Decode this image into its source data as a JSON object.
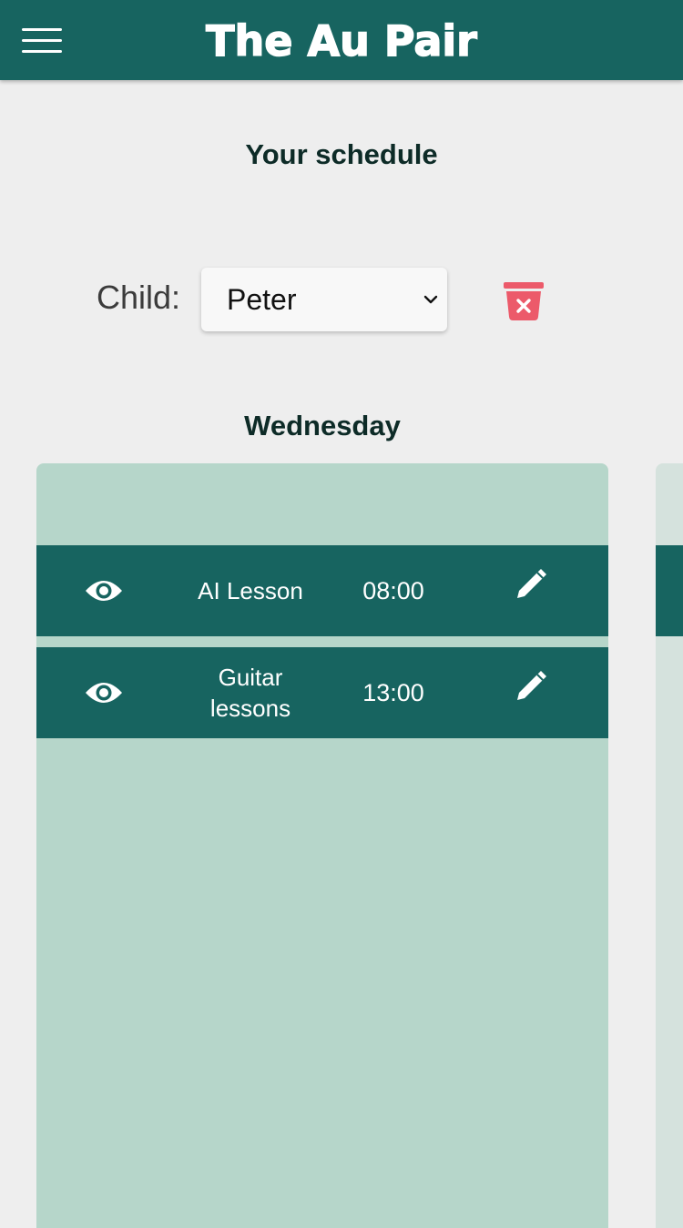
{
  "header": {
    "app_title": "The Au Pair",
    "menu_icon": "hamburger-menu-icon"
  },
  "page": {
    "heading": "Your schedule"
  },
  "child_picker": {
    "label": "Child:",
    "selected": "Peter",
    "delete_icon": "trash-delete-icon",
    "delete_color": "#ec5a6a"
  },
  "schedule": {
    "day": "Wednesday",
    "lessons": [
      {
        "name": "AI Lesson",
        "time": "08:00"
      },
      {
        "name": "Guitar lessons",
        "time": "13:00"
      }
    ]
  },
  "colors": {
    "brand": "#176460",
    "panel": "#b6d6ca",
    "background": "#eeeeee"
  }
}
